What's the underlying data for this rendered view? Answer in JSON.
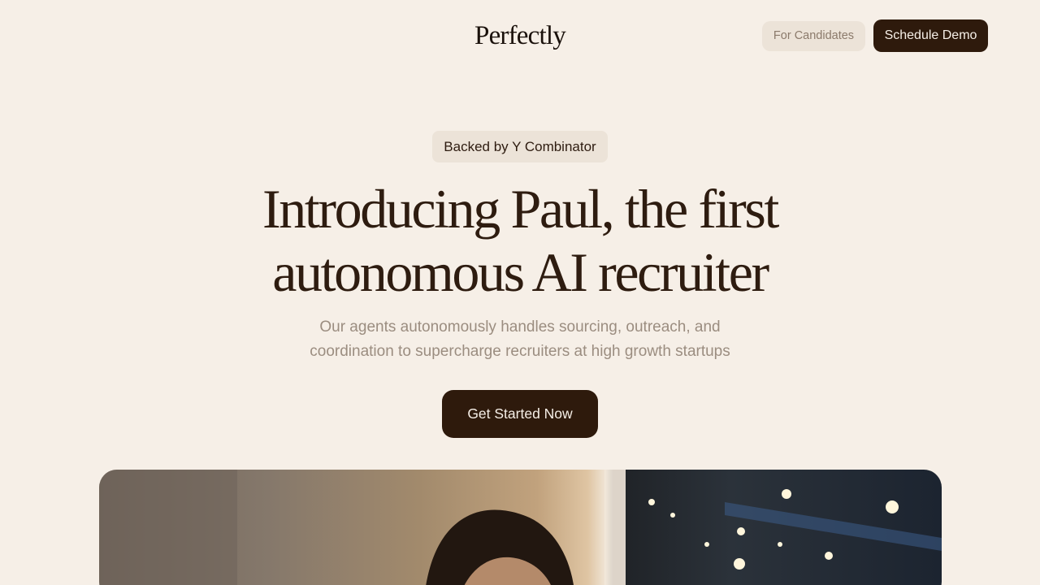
{
  "header": {
    "logo": "Perfectly",
    "nav_secondary_label": "For Candidates",
    "nav_primary_label": "Schedule Demo"
  },
  "hero": {
    "badge": "Backed by Y Combinator",
    "headline_line1": "Introducing Paul, the first",
    "headline_line2": "autonomous AI recruiter",
    "subhead_line1": "Our agents autonomously handles sourcing, outreach, and",
    "subhead_line2": "coordination to supercharge recruiters at high growth startups",
    "cta_label": "Get Started Now"
  },
  "colors": {
    "background": "#f6efe7",
    "brand_dark": "#2e1a0c",
    "muted_text": "#9b8d80",
    "chip_bg": "#ece3d8"
  }
}
